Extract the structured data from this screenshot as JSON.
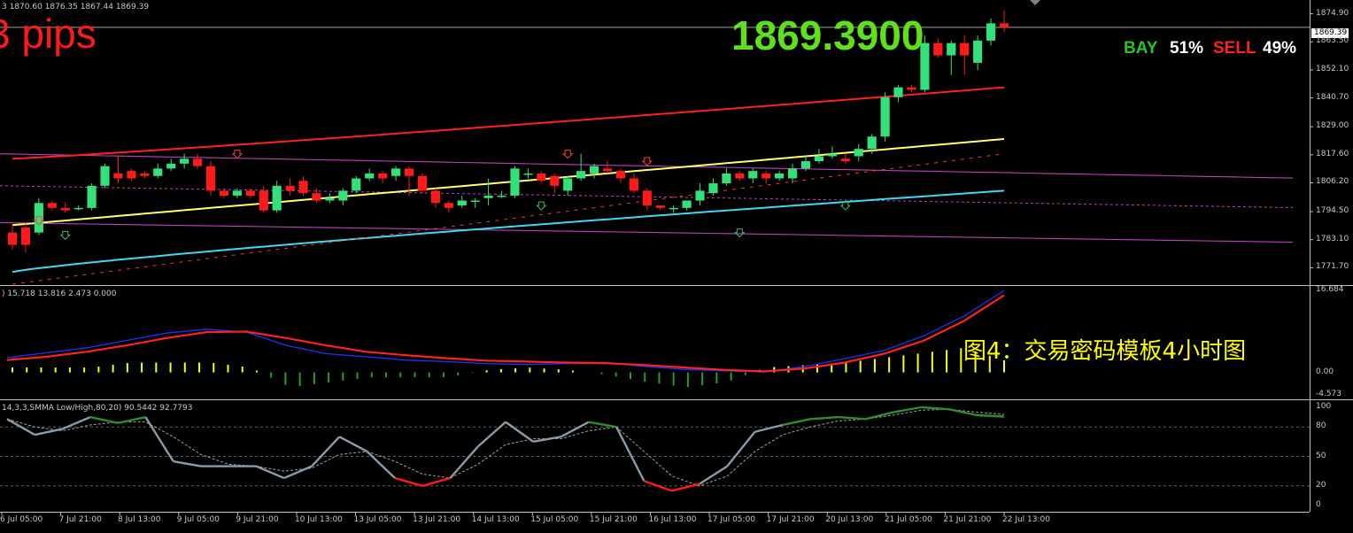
{
  "header": {
    "ohlc": "3 1870.60 1876.35 1867.44 1869.39",
    "pips": "3 pips",
    "big_price": "1869.3900",
    "bay_label": "BAY",
    "bay_value": "51%",
    "sell_label": "SELL",
    "sell_value": "49%",
    "current_price": "1869.39"
  },
  "macd_panel": {
    "header": ") 15.718 13.816 2.473 0.000",
    "caption": "图4：交易密码模板4小时图"
  },
  "stoch_panel": {
    "header": "14,3,3,SMMA Low/High,80,20) 90.5442 92.7793"
  },
  "colors": {
    "bull": "#33e07a",
    "bear": "#ff1a1a",
    "ma_yellow": "#ffff66",
    "ma_red": "#ff2020",
    "ma_cyan": "#40d8f0",
    "band": "#c040c0"
  },
  "chart_data": [
    {
      "type": "candlestick",
      "panel": "price",
      "ylim": [
        1765.0,
        1880.5
      ],
      "yticks": [
        "1874.90",
        "1863.50",
        "1852.10",
        "1840.70",
        "1829.00",
        "1817.60",
        "1806.20",
        "1794.50",
        "1783.10",
        "1771.70"
      ],
      "xticks": [
        "6 Jul 05:00",
        "7 Jul 21:00",
        "8 Jul 13:00",
        "9 Jul 05:00",
        "9 Jul 21:00",
        "10 Jul 13:00",
        "13 Jul 05:00",
        "13 Jul 21:00",
        "14 Jul 13:00",
        "15 Jul 05:00",
        "15 Jul 21:00",
        "16 Jul 13:00",
        "17 Jul 05:00",
        "17 Jul 21:00",
        "20 Jul 13:00",
        "21 Jul 05:00",
        "21 Jul 21:00",
        "22 Jul 13:00"
      ],
      "candles": [
        [
          1786,
          1781,
          1789,
          1779
        ],
        [
          1788,
          1781,
          1790,
          1778
        ],
        [
          1786,
          1798,
          1800,
          1785
        ],
        [
          1798,
          1796,
          1799,
          1795
        ],
        [
          1796,
          1795,
          1798,
          1794
        ],
        [
          1796,
          1796,
          1797,
          1795
        ],
        [
          1796,
          1805,
          1806,
          1795
        ],
        [
          1805,
          1813,
          1814,
          1804
        ],
        [
          1810,
          1808,
          1817,
          1806
        ],
        [
          1811,
          1808,
          1812,
          1807
        ],
        [
          1810,
          1809,
          1811,
          1808
        ],
        [
          1809,
          1812,
          1814,
          1808
        ],
        [
          1812,
          1814,
          1816,
          1811
        ],
        [
          1814,
          1816,
          1818,
          1812
        ],
        [
          1816,
          1813,
          1818,
          1812
        ],
        [
          1813,
          1803,
          1815,
          1801
        ],
        [
          1803,
          1801,
          1804,
          1800
        ],
        [
          1801,
          1803,
          1804,
          1800
        ],
        [
          1803,
          1801,
          1804,
          1800
        ],
        [
          1803,
          1795,
          1805,
          1794
        ],
        [
          1795,
          1805,
          1807,
          1794
        ],
        [
          1805,
          1803,
          1808,
          1801
        ],
        [
          1807,
          1802,
          1809,
          1801
        ],
        [
          1802,
          1799,
          1804,
          1798
        ],
        [
          1799,
          1800,
          1802,
          1798
        ],
        [
          1799,
          1803,
          1804,
          1797
        ],
        [
          1803,
          1808,
          1809,
          1802
        ],
        [
          1808,
          1810,
          1812,
          1807
        ],
        [
          1810,
          1808,
          1811,
          1806
        ],
        [
          1809,
          1812,
          1813,
          1807
        ],
        [
          1812,
          1809,
          1813,
          1801
        ],
        [
          1809,
          1803,
          1810,
          1802
        ],
        [
          1803,
          1798,
          1804,
          1796
        ],
        [
          1798,
          1796,
          1799,
          1794
        ],
        [
          1797,
          1799,
          1801,
          1796
        ],
        [
          1799,
          1799,
          1800,
          1796
        ],
        [
          1800,
          1801,
          1808,
          1797
        ],
        [
          1801,
          1801,
          1803,
          1800
        ],
        [
          1801,
          1812,
          1813,
          1800
        ],
        [
          1810,
          1810,
          1812,
          1808
        ],
        [
          1810,
          1807,
          1811,
          1806
        ],
        [
          1809,
          1805,
          1810,
          1802
        ],
        [
          1803,
          1808,
          1809,
          1801
        ],
        [
          1808,
          1811,
          1818,
          1807
        ],
        [
          1810,
          1813,
          1814,
          1808
        ],
        [
          1812,
          1811,
          1815,
          1810
        ],
        [
          1811,
          1808,
          1812,
          1806
        ],
        [
          1808,
          1803,
          1810,
          1802
        ],
        [
          1803,
          1797,
          1804,
          1795
        ],
        [
          1797,
          1796,
          1797,
          1795
        ],
        [
          1796,
          1796,
          1797,
          1794
        ],
        [
          1796,
          1799,
          1799,
          1795
        ],
        [
          1799,
          1803,
          1806,
          1797
        ],
        [
          1802,
          1806,
          1808,
          1801
        ],
        [
          1806,
          1810,
          1812,
          1805
        ],
        [
          1810,
          1808,
          1811,
          1807
        ],
        [
          1808,
          1811,
          1812,
          1806
        ],
        [
          1810,
          1808,
          1811,
          1806
        ],
        [
          1808,
          1810,
          1811,
          1807
        ],
        [
          1808,
          1812,
          1814,
          1806
        ],
        [
          1812,
          1815,
          1817,
          1811
        ],
        [
          1815,
          1817,
          1820,
          1814
        ],
        [
          1817,
          1818,
          1821,
          1816
        ],
        [
          1816,
          1815,
          1818,
          1814
        ],
        [
          1817,
          1820,
          1822,
          1815
        ],
        [
          1820,
          1825,
          1826,
          1818
        ],
        [
          1825,
          1841,
          1843,
          1823
        ],
        [
          1841,
          1845,
          1846,
          1839
        ],
        [
          1845,
          1844,
          1846,
          1843
        ],
        [
          1844,
          1863,
          1866,
          1843
        ],
        [
          1863,
          1858,
          1865,
          1857
        ],
        [
          1858,
          1863,
          1864,
          1850
        ],
        [
          1863,
          1858,
          1866,
          1850
        ],
        [
          1855,
          1864,
          1866,
          1852
        ],
        [
          1864,
          1871,
          1873,
          1862
        ],
        [
          1871,
          1869.39,
          1876.35,
          1867.44
        ]
      ]
    },
    {
      "type": "line",
      "panel": "macd",
      "ylim": [
        -4.573,
        16.684
      ],
      "yticks": [
        "16.684",
        "0.00",
        "-4.573"
      ],
      "series": [
        {
          "values": [
            3,
            4,
            5,
            6.5,
            8,
            8.8,
            8.2,
            5.5,
            3.8,
            3.2,
            2.5,
            2.2,
            1.8,
            1.6,
            1.8,
            2.0,
            1.2,
            0.6,
            0.3,
            0.1,
            1.2,
            2.8,
            4.5,
            7.5,
            11.5,
            16.684
          ]
        },
        {
          "values": [
            2.5,
            3.2,
            4.2,
            5.5,
            7,
            8.2,
            8.3,
            7,
            5.5,
            4.2,
            3.5,
            2.9,
            2.4,
            2.2,
            2.0,
            1.9,
            1.5,
            1.0,
            0.5,
            0.2,
            0.8,
            2.0,
            3.8,
            6.5,
            10.5,
            15.718
          ]
        },
        {
          "values": [
            1,
            1,
            1,
            2,
            2,
            2,
            1,
            -3,
            -2,
            -1,
            -1,
            -1,
            0.5,
            1,
            0.5,
            -0.5,
            -2,
            -3,
            -2,
            1,
            1.5,
            2,
            3,
            4,
            5,
            2.473
          ]
        }
      ]
    },
    {
      "type": "line",
      "panel": "stochastic",
      "ylim": [
        0,
        100
      ],
      "yticks": [
        "100",
        "80",
        "50",
        "20",
        "0"
      ],
      "series": [
        {
          "values": [
            88,
            72,
            78,
            90,
            84,
            90,
            45,
            40,
            40,
            40,
            28,
            40,
            70,
            55,
            28,
            20,
            28,
            60,
            85,
            65,
            70,
            85,
            80,
            25,
            15,
            22,
            40,
            75,
            82,
            88,
            90,
            88,
            95,
            100,
            98,
            92,
            90.5442
          ]
        },
        {
          "values": [
            88,
            80,
            76,
            82,
            85,
            85,
            70,
            52,
            42,
            40,
            35,
            38,
            52,
            55,
            45,
            32,
            28,
            42,
            62,
            68,
            68,
            76,
            80,
            55,
            30,
            20,
            30,
            55,
            72,
            80,
            86,
            88,
            92,
            97,
            98,
            95,
            92.7793
          ]
        }
      ]
    }
  ]
}
